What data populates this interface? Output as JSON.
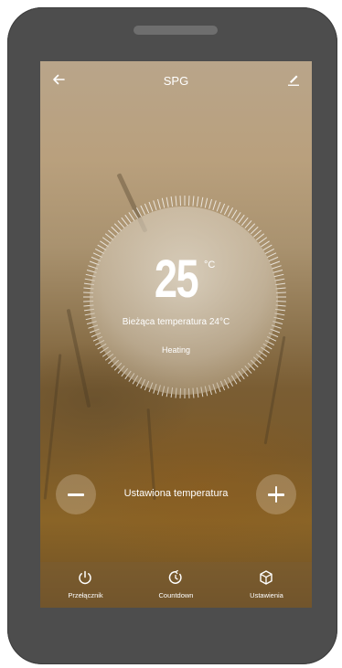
{
  "header": {
    "title": "SPG"
  },
  "thermostat": {
    "set_temperature": "25",
    "unit": "°C",
    "current_temperature_text": "Bieżąca temperatura 24°C",
    "mode": "Heating"
  },
  "controls": {
    "label": "Ustawiona temperatura"
  },
  "tabs": [
    {
      "label": "Przełącznik",
      "icon": "power-icon"
    },
    {
      "label": "Countdown",
      "icon": "timer-icon"
    },
    {
      "label": "Ustawienia",
      "icon": "settings-cube-icon"
    }
  ]
}
